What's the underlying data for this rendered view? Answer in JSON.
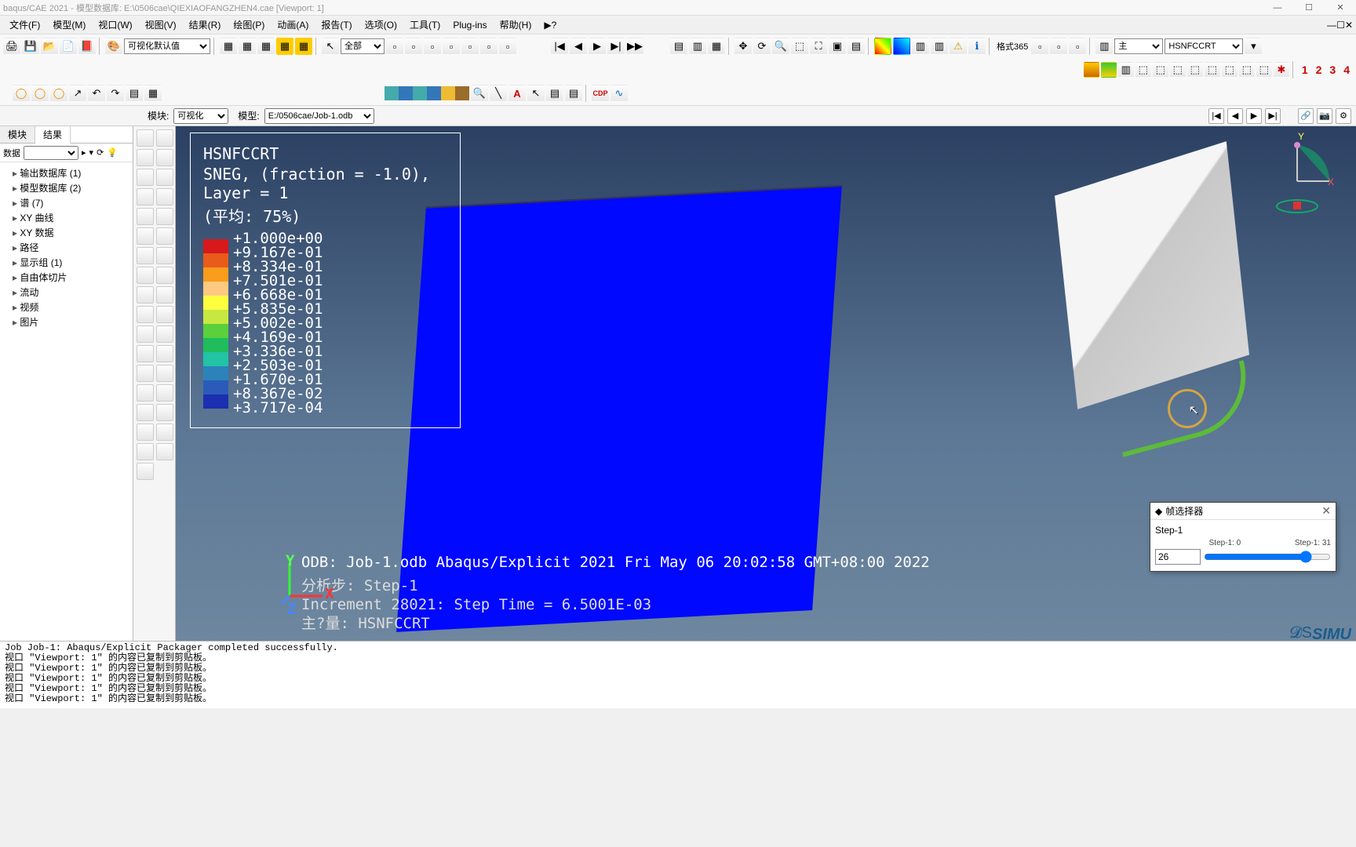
{
  "window": {
    "title": "baqus/CAE 2021 - 模型数据库: E:\\0506cae\\QIEXIAOFANGZHEN4.cae [Viewport: 1]"
  },
  "menu": {
    "file": "文件(F)",
    "model": "模型(M)",
    "viewport": "视口(W)",
    "view": "视图(V)",
    "results": "结果(R)",
    "plot": "绘图(P)",
    "animation": "动画(A)",
    "report": "报告(T)",
    "options": "选项(O)",
    "tools": "工具(T)",
    "plugins": "Plug-ins",
    "help": "帮助(H)",
    "whats": "▶?"
  },
  "toolbar1": {
    "renderStyle": "可视化默认值",
    "viewScope": "全部",
    "gridLabel": "格式365",
    "fieldVar": "HSNFCCRT",
    "symbolSet": "主"
  },
  "moduleBar": {
    "moduleLabel": "模块:",
    "moduleValue": "可视化",
    "modelLabel": "模型:",
    "modelValue": "E:/0506cae/Job-1.odb"
  },
  "tree": {
    "tab1": "模块",
    "tab2": "结果",
    "filterLabel": "数据",
    "items": [
      "输出数据库 (1)",
      "模型数据库 (2)",
      "谱 (7)",
      "XY 曲线",
      "XY 数据",
      "路径",
      "显示组 (1)",
      "自由体切片",
      "流动",
      "视频",
      "图片"
    ]
  },
  "legend": {
    "title": "HSNFCCRT",
    "subtitle": "SNEG, (fraction = -1.0), Layer = 1",
    "avg": "(平均: 75%)",
    "colors": [
      "#d7191c",
      "#e85b1b",
      "#f99d1c",
      "#fec980",
      "#ffff40",
      "#c7e840",
      "#5ad03d",
      "#1fbd5b",
      "#23c3a5",
      "#2b83ba",
      "#2b5bba",
      "#1b2fb0"
    ],
    "labels": [
      "+1.000e+00",
      "+9.167e-01",
      "+8.334e-01",
      "+7.501e-01",
      "+6.668e-01",
      "+5.835e-01",
      "+5.002e-01",
      "+4.169e-01",
      "+3.336e-01",
      "+2.503e-01",
      "+1.670e-01",
      "+8.367e-02",
      "+3.717e-04"
    ]
  },
  "overlay": {
    "line1": "ODB: Job-1.odb    Abaqus/Explicit 2021    Fri May 06 20:02:58 GMT+08:00 2022",
    "line2": "分析步: Step-1",
    "line3": "Increment     28021: Step Time =   6.5001E-03",
    "line4": "主?量: HSNFCCRT"
  },
  "triad": {
    "x": "X",
    "y": "Y",
    "z": "Z"
  },
  "frameDialog": {
    "title": "帧选择器",
    "step": "Step-1",
    "startLabel": "Step-1: 0",
    "endLabel": "Step-1: 31",
    "value": "26"
  },
  "brand": {
    "simulia": "SIMU",
    "ds": "DS"
  },
  "messages": "Job Job-1: Abaqus/Explicit Packager completed successfully.\n视口 \"Viewport: 1\" 的内容已复制到剪贴板。\n视口 \"Viewport: 1\" 的内容已复制到剪贴板。\n视口 \"Viewport: 1\" 的内容已复制到剪贴板。\n视口 \"Viewport: 1\" 的内容已复制到剪贴板。\n视口 \"Viewport: 1\" 的内容已复制到剪贴板。"
}
